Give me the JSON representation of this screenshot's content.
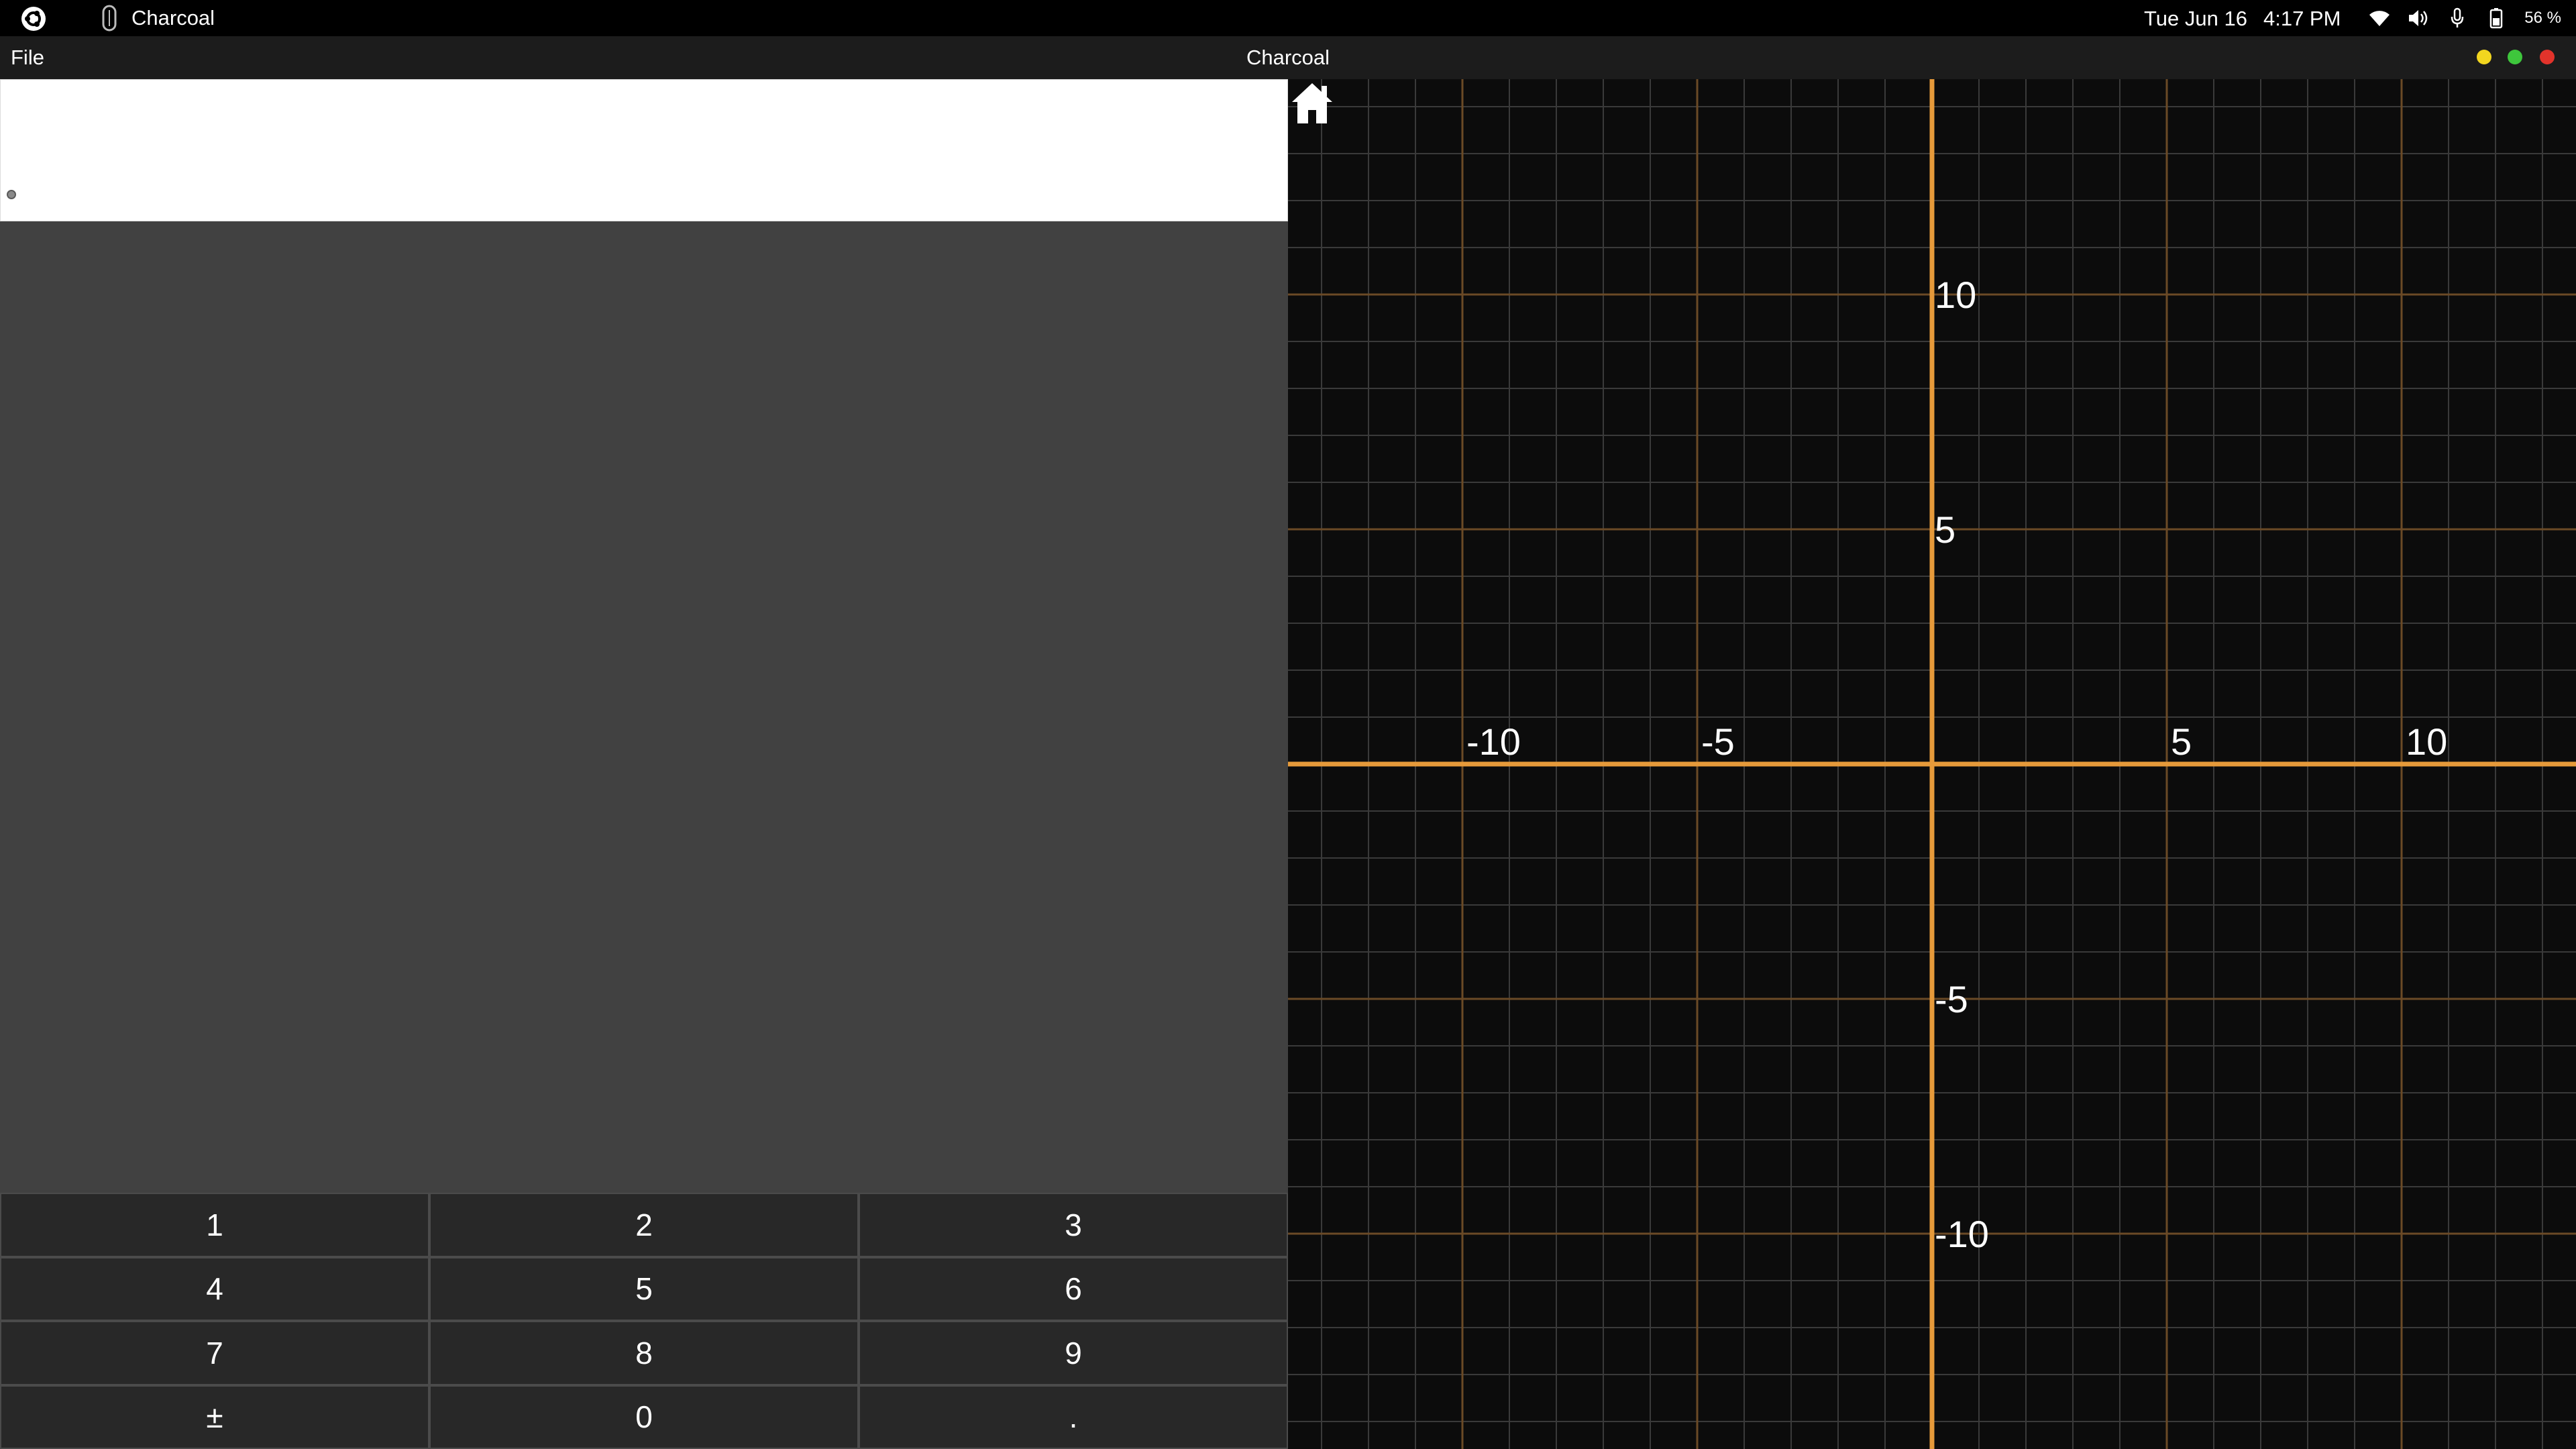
{
  "system_bar": {
    "app_name": "Charcoal",
    "date": "Tue Jun 16",
    "time": "4:17 PM",
    "battery_percent": "56 %",
    "icons": [
      "ubuntu-logo-icon",
      "app-icon",
      "wifi-icon",
      "volume-icon",
      "microphone-icon",
      "battery-icon"
    ]
  },
  "window": {
    "title": "Charcoal",
    "menu": {
      "file_label": "File"
    },
    "controls": {
      "minimize_color": "#f2d61f",
      "maximize_color": "#3ec63c",
      "close_color": "#e2332b"
    }
  },
  "expression": {
    "value": ""
  },
  "keypad": {
    "keys": [
      "1",
      "2",
      "3",
      "4",
      "5",
      "6",
      "7",
      "8",
      "9",
      "±",
      "0",
      "."
    ]
  },
  "graph": {
    "axis_color": "#e69a3a",
    "major_grid_color": "#6b4a26",
    "minor_grid_color": "#3a3a3a",
    "x_tick_labels": [
      "-10",
      "-5",
      "5",
      "10"
    ],
    "y_tick_labels": [
      "10",
      "5",
      "-5",
      "-10"
    ],
    "home_icon": "home-icon"
  },
  "chart_data": {
    "type": "scatter",
    "title": "",
    "xlabel": "",
    "ylabel": "",
    "xlim": [
      -13.7,
      13.7
    ],
    "ylim": [
      -14.6,
      14.6
    ],
    "x_ticks": [
      -10,
      -5,
      5,
      10
    ],
    "y_ticks": [
      10,
      5,
      -5,
      -10
    ],
    "grid": true,
    "series": []
  }
}
